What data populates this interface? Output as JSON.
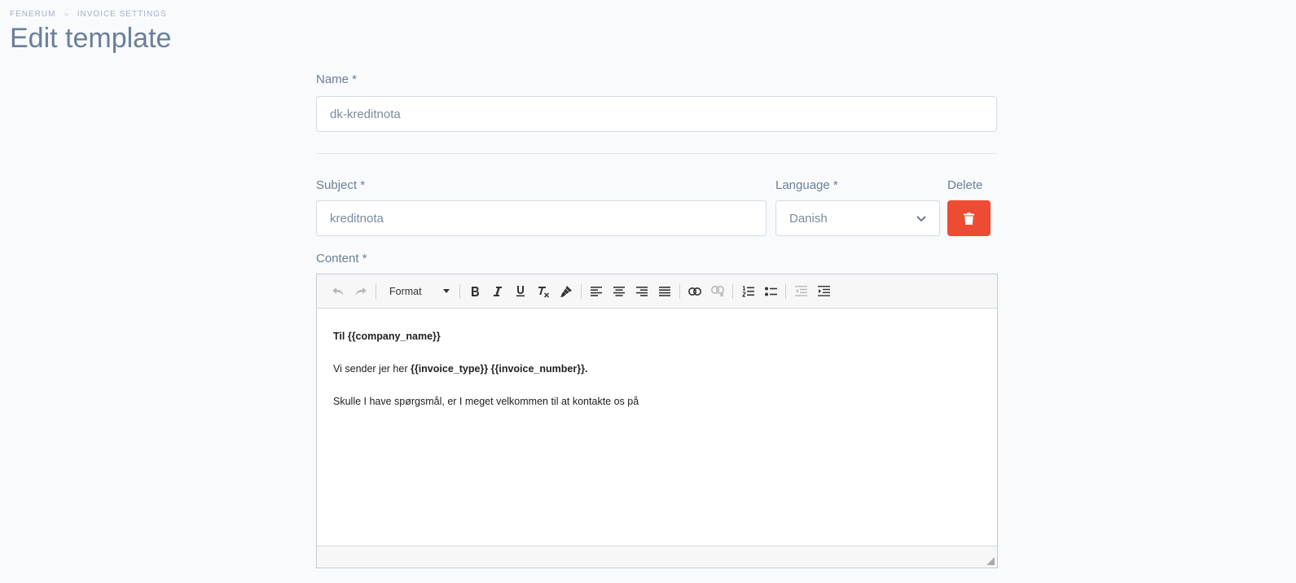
{
  "breadcrumb": {
    "root": "FENERUM",
    "separator": ">",
    "current": "INVOICE SETTINGS"
  },
  "page_title": "Edit template",
  "form": {
    "name_label": "Name *",
    "name_value": "dk-kreditnota",
    "subject_label": "Subject *",
    "subject_value": "kreditnota",
    "language_label": "Language *",
    "language_value": "Danish",
    "delete_label": "Delete",
    "content_label": "Content *"
  },
  "editor": {
    "format_label": "Format",
    "line1_bold": "Til {{company_name}}",
    "line2_plain": "Vi sender jer her ",
    "line2_bold": "{{invoice_type}} {{invoice_number}}.",
    "line3_plain": "Skulle I have spørgsmål, er I meget velkommen til at kontakte os på"
  },
  "colors": {
    "danger": "#ee4b33",
    "text_muted": "#6b7f99",
    "background": "#f8fafc"
  }
}
